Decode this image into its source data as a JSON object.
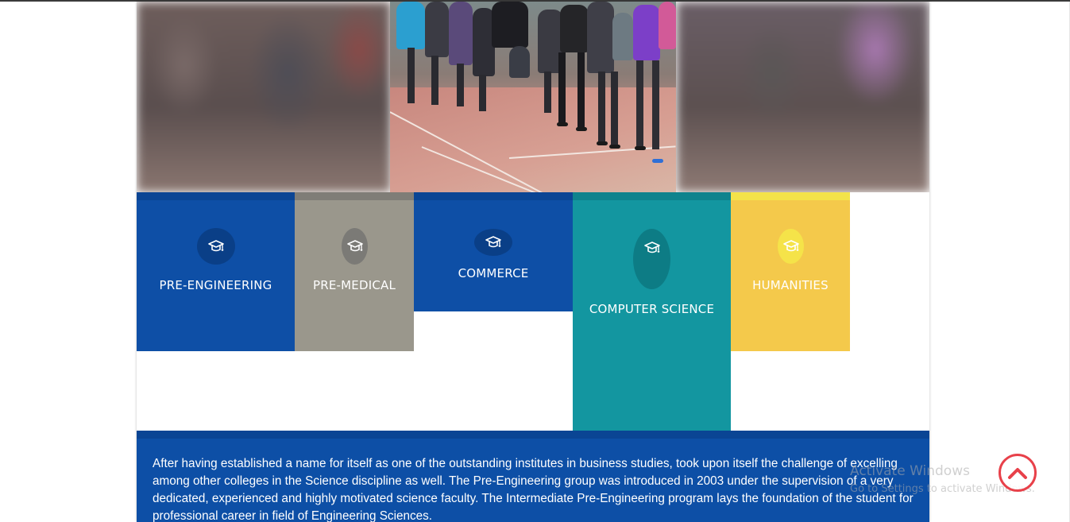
{
  "hero": {
    "image_icon": "athletics-track-photo"
  },
  "courses": [
    {
      "label": "PRE-ENGINEERING",
      "icon": "graduation-cap-icon",
      "color": "#0e4fa6",
      "band": "#0b4594",
      "circle": "#0a3f87"
    },
    {
      "label": "PRE-MEDICAL",
      "icon": "graduation-cap-icon",
      "color": "#9a978c",
      "band": "#7f7d77",
      "circle": "#7b7a76"
    },
    {
      "label": "COMMERCE",
      "icon": "graduation-cap-icon",
      "color": "#0e4fa6",
      "band": "#0b4594",
      "circle": "#0a3f87"
    },
    {
      "label": "COMPUTER SCIENCE",
      "icon": "graduation-cap-icon",
      "color": "#1396a0",
      "band": "#0e838d",
      "circle": "#0d7c85"
    },
    {
      "label": "HUMANITIES",
      "icon": "graduation-cap-icon",
      "color": "#f4c94b",
      "band": "#f3e34a",
      "circle": "#f5e349"
    }
  ],
  "description": {
    "text": "After having established a name for itself as one of the outstanding institutes in business studies, took upon itself the challenge of excelling among other colleges in the Science discipline as well. The Pre-Engineering group was introduced in 2003 under the supervision of a very dedicated, experienced and highly motivated science faculty. The Intermediate Pre-Engineering program lays the foundation of the student for professional career in field of Engineering Sciences."
  },
  "watermark": {
    "title": "Activate Windows",
    "subtitle": "Go to Settings to activate Windows."
  },
  "scroll_top": {
    "icon": "chevron-up-icon",
    "color": "#e8414a"
  }
}
